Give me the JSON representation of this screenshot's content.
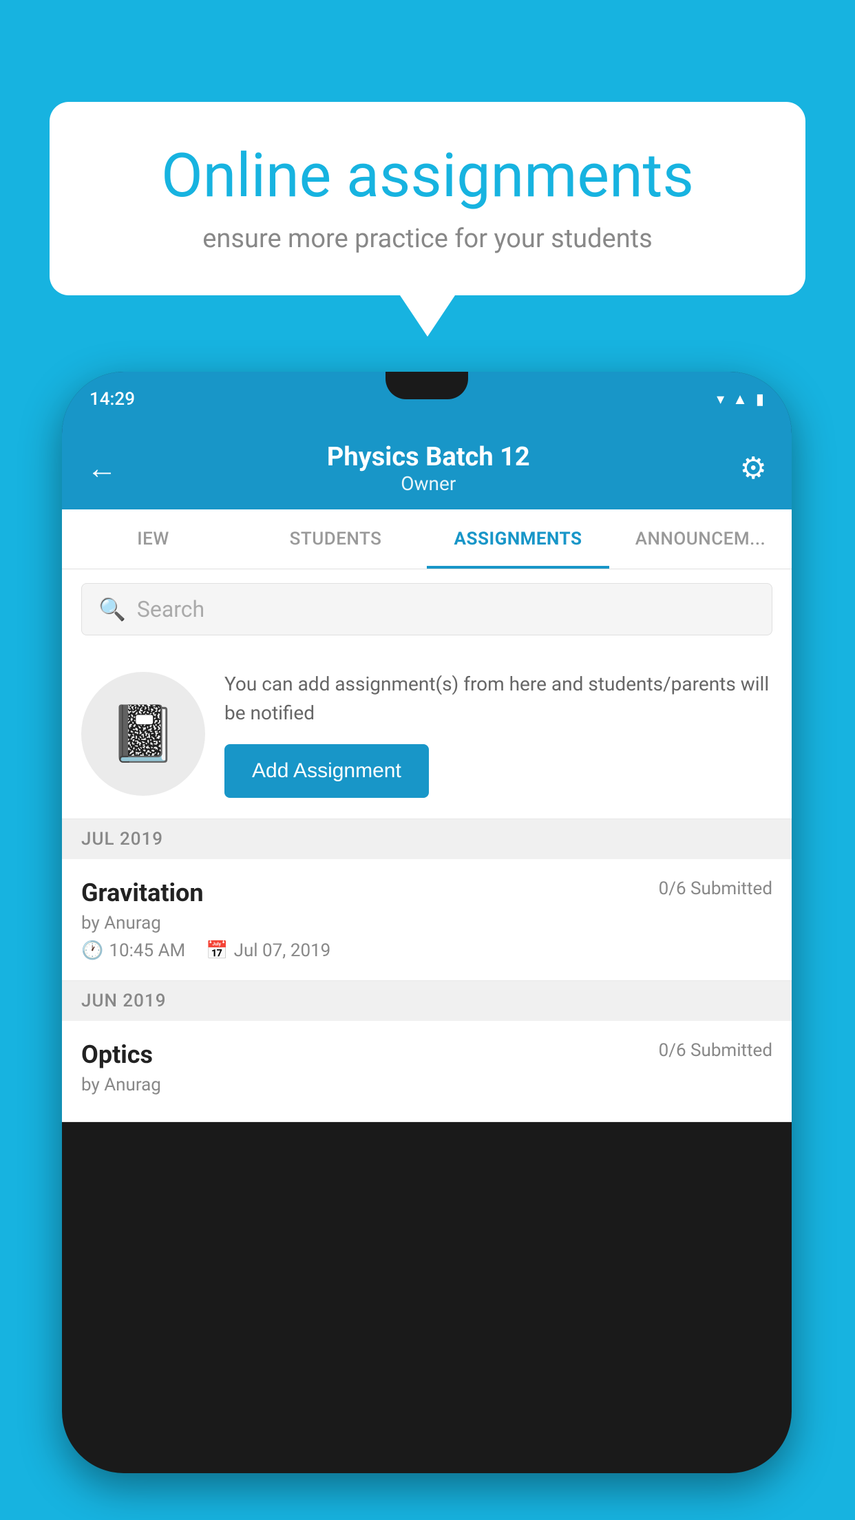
{
  "background_color": "#17b3e0",
  "speech_bubble": {
    "title": "Online assignments",
    "subtitle": "ensure more practice for your students"
  },
  "phone": {
    "status_bar": {
      "time": "14:29"
    },
    "header": {
      "title": "Physics Batch 12",
      "subtitle": "Owner",
      "back_label": "←",
      "gear_label": "⚙"
    },
    "tabs": [
      {
        "label": "IEW",
        "active": false
      },
      {
        "label": "STUDENTS",
        "active": false
      },
      {
        "label": "ASSIGNMENTS",
        "active": true
      },
      {
        "label": "ANNOUNCEM...",
        "active": false
      }
    ],
    "search": {
      "placeholder": "Search"
    },
    "add_assignment_card": {
      "description": "You can add assignment(s) from here and students/parents will be notified",
      "button_label": "Add Assignment"
    },
    "month_sections": [
      {
        "month_label": "JUL 2019",
        "assignments": [
          {
            "name": "Gravitation",
            "submitted": "0/6 Submitted",
            "by": "by Anurag",
            "time": "10:45 AM",
            "date": "Jul 07, 2019"
          }
        ]
      },
      {
        "month_label": "JUN 2019",
        "assignments": [
          {
            "name": "Optics",
            "submitted": "0/6 Submitted",
            "by": "by Anurag",
            "time": "",
            "date": ""
          }
        ]
      }
    ]
  }
}
